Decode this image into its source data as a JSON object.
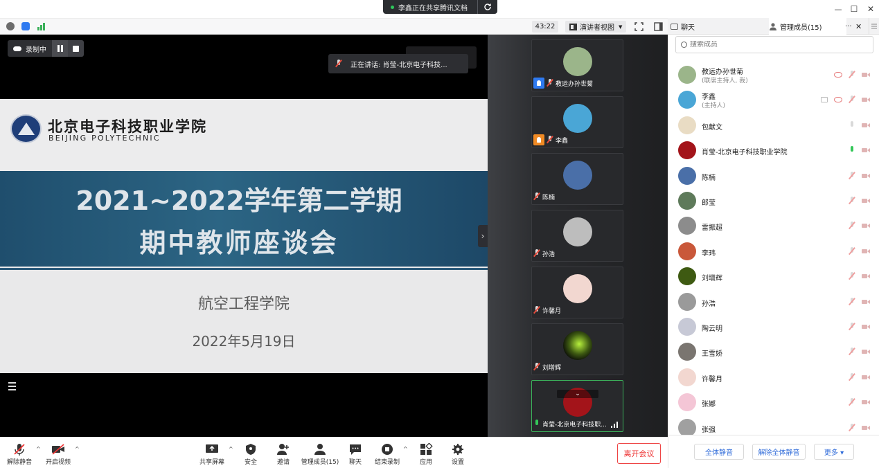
{
  "titlebar": {
    "share_notice": "李鑫正在共享腾讯文档",
    "min_glyph": "—",
    "max_glyph": "☐",
    "close_glyph": "✕"
  },
  "toolbar": {
    "timer": "43:22",
    "view_mode": "演讲者视图"
  },
  "panel_tabs": {
    "chat": "聊天",
    "members": "管理成员(15)",
    "more": "···",
    "close": "✕"
  },
  "stage": {
    "recording_label": "录制中",
    "speaking": "正在讲话: 肖莹-北京电子科技..."
  },
  "slide": {
    "school_cn": "北京电子科技职业学院",
    "school_en": "BEIJING POLYTECHNIC",
    "title_line1": "2021~2022学年第二学期",
    "title_line2": "期中教师座谈会",
    "department": "航空工程学院",
    "date": "2022年5月19日"
  },
  "video_tiles": [
    {
      "name": "教运办孙世菊",
      "role": "cohost",
      "mic": "off",
      "avatar_color": "#9bb58a"
    },
    {
      "name": "李鑫",
      "role": "host",
      "mic": "off",
      "avatar_color": "#4aa6d6"
    },
    {
      "name": "陈楠",
      "role": "",
      "mic": "off",
      "avatar_color": "#4a6fa8"
    },
    {
      "name": "孙浩",
      "role": "",
      "mic": "off",
      "avatar_color": "#bdbdbd"
    },
    {
      "name": "许馨月",
      "role": "",
      "mic": "off",
      "avatar_color": "#f2d7d0"
    },
    {
      "name": "刘增辉",
      "role": "",
      "mic": "off",
      "avatar_color": "#3e5a12"
    },
    {
      "name": "肖莹-北京电子科技职...",
      "role": "",
      "mic": "on",
      "avatar_color": "#a3141a"
    }
  ],
  "member_panel": {
    "search_placeholder": "搜索成员",
    "members": [
      {
        "name": "教运办孙世菊",
        "sub": "(联席主持人, 我)",
        "mic": "off",
        "avatar_color": "#9bb58a"
      },
      {
        "name": "李鑫",
        "sub": "(主持人)",
        "mic": "off",
        "avatar_color": "#4aa6d6"
      },
      {
        "name": "包献文",
        "sub": "",
        "mic": "idle",
        "avatar_color": "#e9dcc4"
      },
      {
        "name": "肖莹-北京电子科技职业学院",
        "sub": "",
        "mic": "on",
        "avatar_color": "#a3141a"
      },
      {
        "name": "陈楠",
        "sub": "",
        "mic": "off",
        "avatar_color": "#4a6fa8"
      },
      {
        "name": "郎莹",
        "sub": "",
        "mic": "off",
        "avatar_color": "#5e7a5a"
      },
      {
        "name": "雷振超",
        "sub": "",
        "mic": "off",
        "avatar_color": "#8c8c8c"
      },
      {
        "name": "李玮",
        "sub": "",
        "mic": "off",
        "avatar_color": "#c9583a"
      },
      {
        "name": "刘增辉",
        "sub": "",
        "mic": "off",
        "avatar_color": "#3e5a12"
      },
      {
        "name": "孙浩",
        "sub": "",
        "mic": "off",
        "avatar_color": "#9a9a9a"
      },
      {
        "name": "陶云明",
        "sub": "",
        "mic": "off",
        "avatar_color": "#c7c9d6"
      },
      {
        "name": "王雪娇",
        "sub": "",
        "mic": "off",
        "avatar_color": "#7a7570"
      },
      {
        "name": "许馨月",
        "sub": "",
        "mic": "off",
        "avatar_color": "#f2d7d0"
      },
      {
        "name": "张娜",
        "sub": "",
        "mic": "off",
        "avatar_color": "#f4c6d6"
      },
      {
        "name": "张强",
        "sub": "",
        "mic": "off",
        "avatar_color": "#a0a0a0"
      }
    ],
    "mute_all": "全体静音",
    "unmute_all": "解除全体静音",
    "more": "更多 ▾"
  },
  "bottombar": {
    "unmute": "解除静音",
    "start_video": "开启视频",
    "share_screen": "共享屏幕",
    "security": "安全",
    "invite": "邀请",
    "manage_members": "管理成员(15)",
    "chat": "聊天",
    "end_recording": "结束录制",
    "apps": "应用",
    "settings": "设置",
    "leave": "离开会议"
  },
  "colors": {
    "accent_blue": "#2f6bd9",
    "leave_red": "#e33333",
    "active_green": "#3bb05a"
  }
}
